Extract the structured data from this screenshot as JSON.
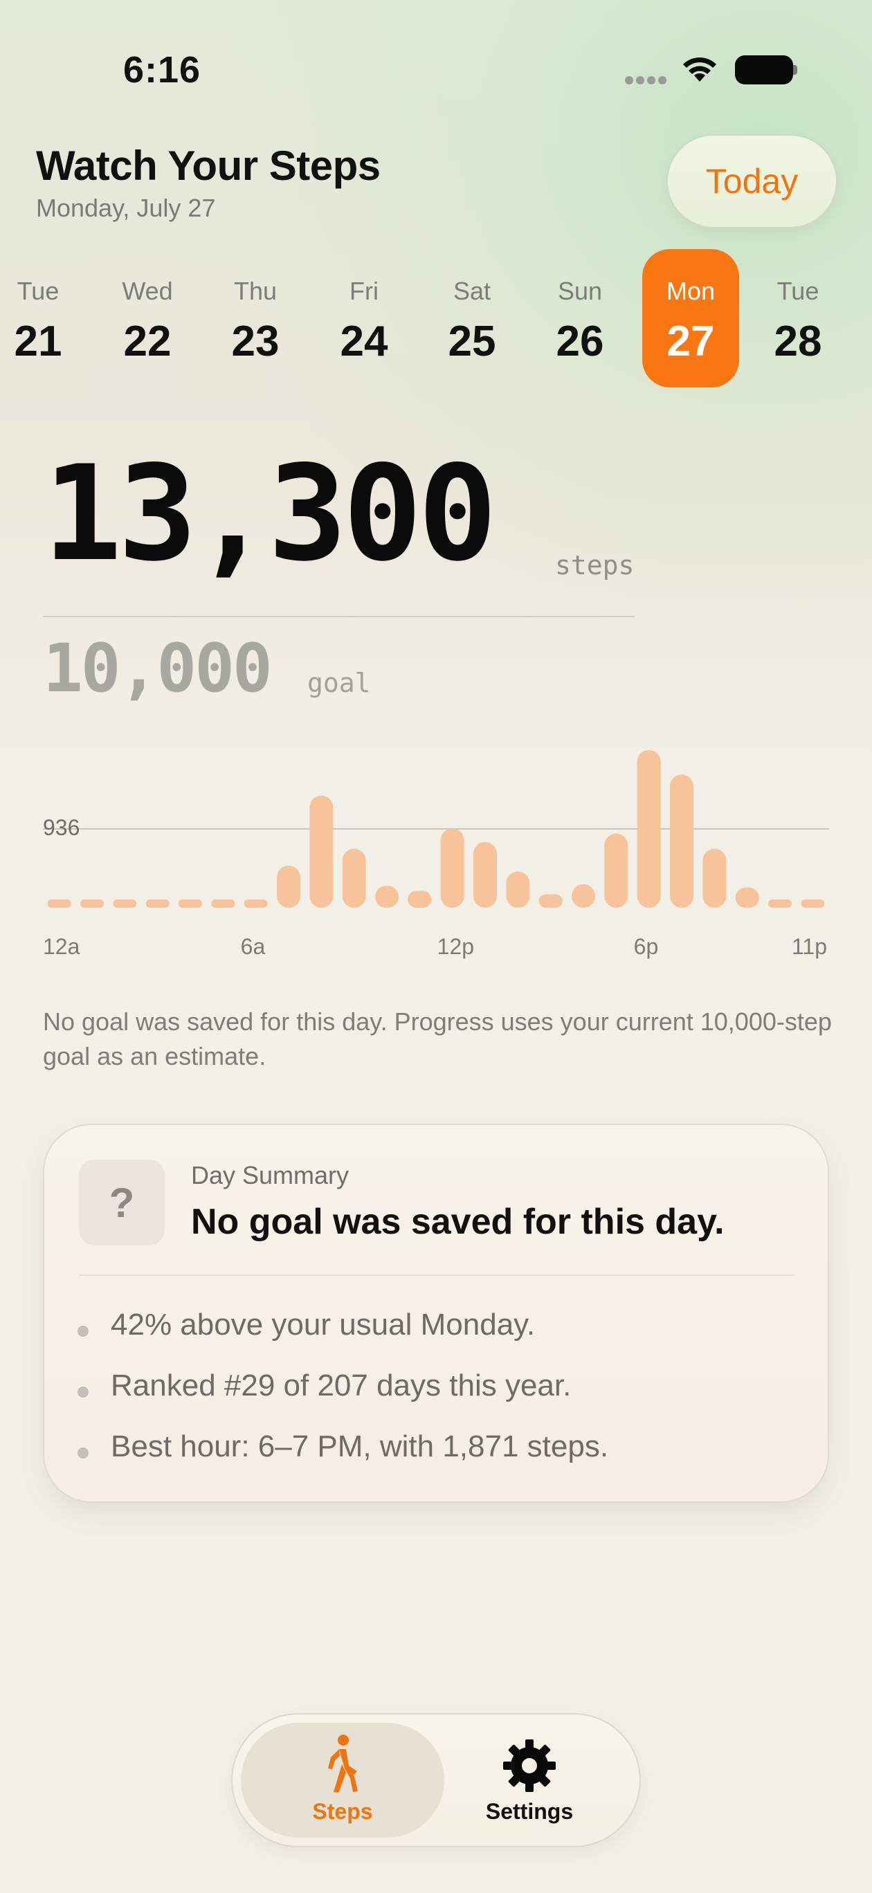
{
  "status_bar": {
    "time": "6:16"
  },
  "header": {
    "title": "Watch Your Steps",
    "date": "Monday, July 27",
    "today_button": "Today"
  },
  "colors": {
    "accent": "#F87713",
    "bar": "#F6C39A",
    "goal_text": "#A7A8A0"
  },
  "days": [
    {
      "name": "Tue",
      "num": "21",
      "selected": false
    },
    {
      "name": "Wed",
      "num": "22",
      "selected": false
    },
    {
      "name": "Thu",
      "num": "23",
      "selected": false
    },
    {
      "name": "Fri",
      "num": "24",
      "selected": false
    },
    {
      "name": "Sat",
      "num": "25",
      "selected": false
    },
    {
      "name": "Sun",
      "num": "26",
      "selected": false
    },
    {
      "name": "Mon",
      "num": "27",
      "selected": true
    },
    {
      "name": "Tue",
      "num": "28",
      "selected": false
    }
  ],
  "stats": {
    "steps": "13,300",
    "steps_unit": "steps",
    "goal": "10,000",
    "goal_unit": "goal"
  },
  "chart_data": {
    "type": "bar",
    "title": "",
    "reference_line": {
      "label": "936",
      "value": 936
    },
    "x_tick_labels": [
      "12a",
      "6a",
      "12p",
      "6p",
      "11p"
    ],
    "categories": [
      "12a",
      "1a",
      "2a",
      "3a",
      "4a",
      "5a",
      "6a",
      "7a",
      "8a",
      "9a",
      "10a",
      "11a",
      "12p",
      "1p",
      "2p",
      "3p",
      "4p",
      "5p",
      "6p",
      "7p",
      "8p",
      "9p",
      "10p",
      "11p"
    ],
    "values": [
      0,
      0,
      0,
      0,
      0,
      0,
      90,
      500,
      1330,
      700,
      260,
      200,
      940,
      780,
      430,
      160,
      280,
      880,
      1871,
      1580,
      700,
      240,
      40,
      40
    ],
    "ylim": [
      0,
      1871
    ]
  },
  "note": "No goal was saved for this day. Progress uses your current 10,000-step goal as an estimate.",
  "summary": {
    "icon": "?",
    "eyebrow": "Day Summary",
    "title": "No goal was saved for this day.",
    "bullets": [
      "42% above your usual Monday.",
      "Ranked #29 of 207 days this year.",
      "Best hour: 6–7 PM, with 1,871 steps."
    ]
  },
  "tabbar": {
    "steps_label": "Steps",
    "settings_label": "Settings",
    "active": "Steps",
    "steps_icon": "walk-icon",
    "settings_icon": "gear-icon"
  }
}
